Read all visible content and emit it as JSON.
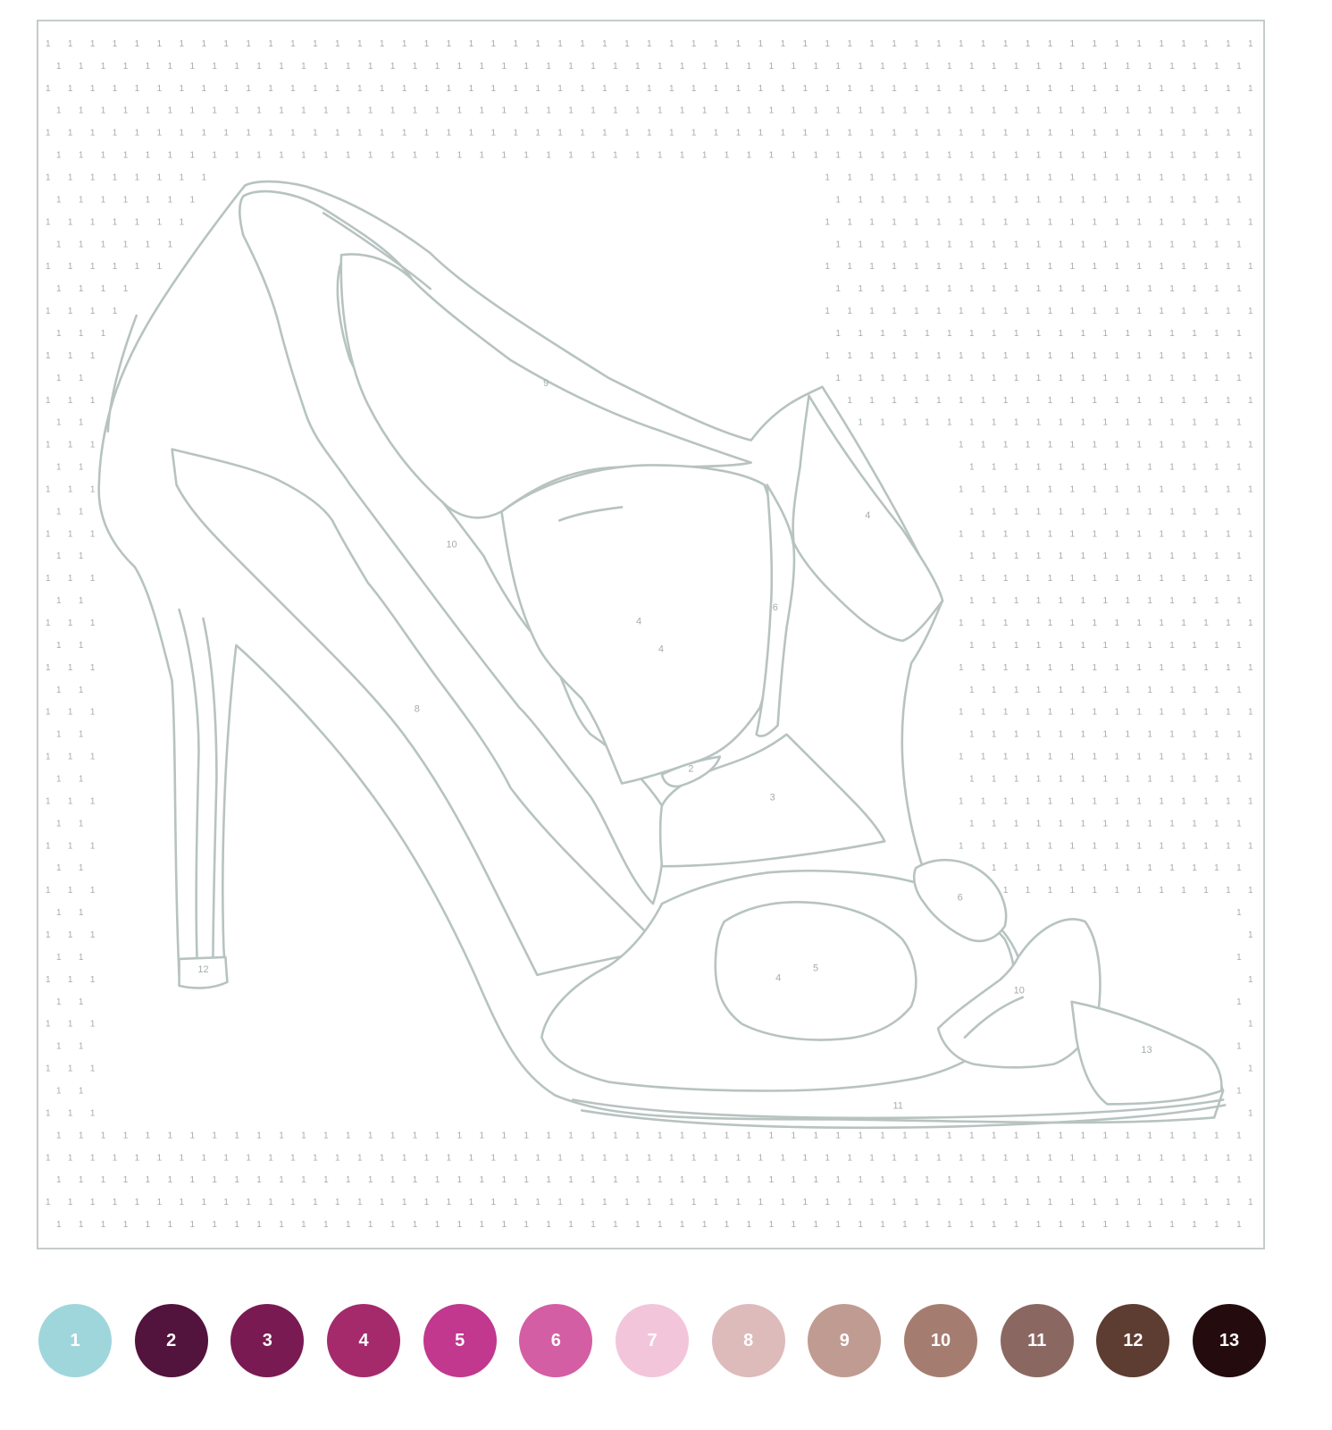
{
  "canvas": {
    "name": "shoe-outline",
    "line_color": "#b7c3c1",
    "grid_number_color": "#a4acab",
    "background_number": "1"
  },
  "regions": [
    {
      "name": "region-heel-side",
      "number": "4"
    },
    {
      "name": "region-inner-lining",
      "number": "10"
    },
    {
      "name": "region-insole",
      "number": "8"
    },
    {
      "name": "region-upper-panel",
      "number": "9"
    },
    {
      "name": "region-bow-left",
      "number": "4"
    },
    {
      "name": "region-bow-right",
      "number": "4"
    },
    {
      "name": "region-bow-knot",
      "number": "6"
    },
    {
      "name": "region-vamp",
      "number": "4"
    },
    {
      "name": "region-vamp-shade",
      "number": "5"
    },
    {
      "name": "region-vamp-highlight",
      "number": "6"
    },
    {
      "name": "region-toe-opening",
      "number": "10"
    },
    {
      "name": "region-heel-tip",
      "number": "12"
    },
    {
      "name": "region-sole-edge",
      "number": "11"
    },
    {
      "name": "region-bow-shadow",
      "number": "3"
    },
    {
      "name": "region-bow-fold",
      "number": "2"
    },
    {
      "name": "region-sole-rim",
      "number": "13"
    }
  ],
  "palette": [
    {
      "number": "1",
      "color": "#9fd6dc"
    },
    {
      "number": "2",
      "color": "#52133c"
    },
    {
      "number": "3",
      "color": "#7a1a52"
    },
    {
      "number": "4",
      "color": "#a42a6c"
    },
    {
      "number": "5",
      "color": "#c1388e"
    },
    {
      "number": "6",
      "color": "#d45ea3"
    },
    {
      "number": "7",
      "color": "#f3c5db"
    },
    {
      "number": "8",
      "color": "#ddbbbb"
    },
    {
      "number": "9",
      "color": "#c09b91"
    },
    {
      "number": "10",
      "color": "#a57d70"
    },
    {
      "number": "11",
      "color": "#8a6861"
    },
    {
      "number": "12",
      "color": "#5d3d31"
    },
    {
      "number": "13",
      "color": "#230b0e"
    }
  ]
}
